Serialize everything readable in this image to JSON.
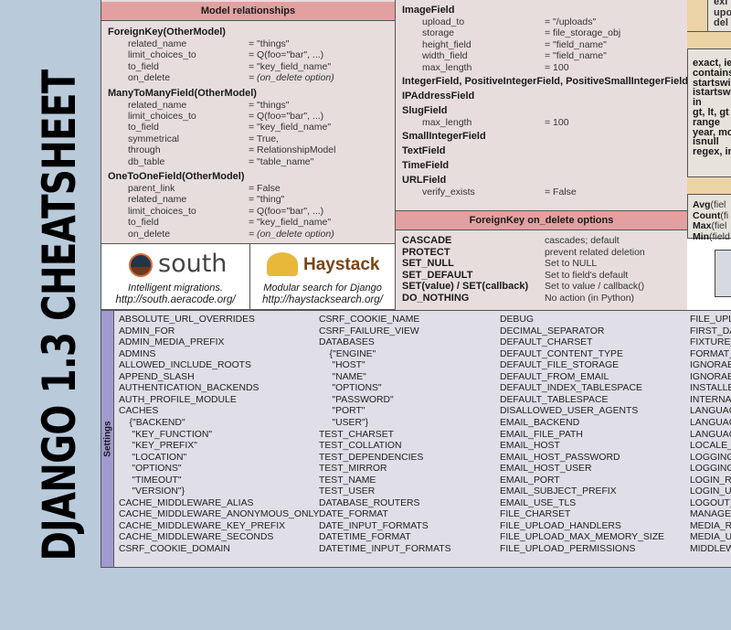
{
  "title": "DJANGO 1.3 CHEATSHEET",
  "model_relationships": {
    "header": "Model relationships",
    "groups": [
      {
        "name": "ForeignKey(OtherModel)",
        "rows": [
          [
            "related_name",
            "= \"things\""
          ],
          [
            "limit_choices_to",
            "= Q(foo=\"bar\", ...)"
          ],
          [
            "to_field",
            "= \"key_field_name\""
          ],
          [
            "on_delete",
            "= (on_delete option)"
          ]
        ]
      },
      {
        "name": "ManyToManyField(OtherModel)",
        "rows": [
          [
            "related_name",
            "= \"things\""
          ],
          [
            "limit_choices_to",
            "= Q(foo=\"bar\", ...)"
          ],
          [
            "to_field",
            "= \"key_field_name\""
          ],
          [
            "symmetrical",
            "= True,"
          ],
          [
            "through",
            "= RelationshipModel"
          ],
          [
            "db_table",
            "= \"table_name\""
          ]
        ]
      },
      {
        "name": "OneToOneField(OtherModel)",
        "rows": [
          [
            "parent_link",
            "= False"
          ],
          [
            "related_name",
            "= \"thing\""
          ],
          [
            "limit_choices_to",
            "= Q(foo=\"bar\", ...)"
          ],
          [
            "to_field",
            "= \"key_field_name\""
          ],
          [
            "on_delete",
            "= (on_delete option)"
          ]
        ]
      }
    ]
  },
  "ads": {
    "south": {
      "logo": "south",
      "tagline": "Intelligent migrations.",
      "url": "http://south.aeracode.org/"
    },
    "haystack": {
      "logo": "Haystack",
      "tagline": "Modular search for Django",
      "url": "http://haystacksearch.org/"
    }
  },
  "fields": [
    {
      "name": "ImageField",
      "rows": [
        [
          "upload_to",
          "= \"/uploads\""
        ],
        [
          "storage",
          "= file_storage_obj"
        ],
        [
          "height_field",
          "= \"field_name\""
        ],
        [
          "width_field",
          "= \"field_name\""
        ],
        [
          "max_length",
          "= 100"
        ]
      ]
    },
    {
      "name": "IntegerField, PositiveIntegerField, PositiveSmallIntegerField",
      "rows": []
    },
    {
      "name": "IPAddressField",
      "rows": []
    },
    {
      "name": "SlugField",
      "rows": [
        [
          "max_length",
          "= 100"
        ]
      ]
    },
    {
      "name": "SmallIntegerField",
      "rows": []
    },
    {
      "name": "TextField",
      "rows": []
    },
    {
      "name": "TimeField",
      "rows": []
    },
    {
      "name": "URLField",
      "rows": [
        [
          "verify_exists",
          "= False"
        ]
      ]
    }
  ],
  "on_delete": {
    "header": "ForeignKey on_delete options",
    "rows": [
      [
        "CASCADE",
        "cascades; default"
      ],
      [
        "PROTECT",
        "prevent related deletion"
      ],
      [
        "SET_NULL",
        "Set to NULL"
      ],
      [
        "SET_DEFAULT",
        "Set to field's default"
      ],
      [
        "SET(value) / SET(callback)",
        "Set to value / callback()"
      ],
      [
        "DO_NOTHING",
        "No action (in Python)"
      ]
    ]
  },
  "right": {
    "top": [
      "exi",
      "upo",
      "del"
    ],
    "lookups": [
      "exact, ie",
      "contains",
      "startswi",
      "istartsw",
      "in",
      "gt, lt, gt",
      "range",
      "year, mo",
      "isnull",
      "regex, ir"
    ],
    "aggregates": [
      [
        "Avg",
        "(fiel"
      ],
      [
        "Count",
        "(fi"
      ],
      [
        "Max",
        "(fiel"
      ],
      [
        "Min",
        "(field"
      ]
    ],
    "book_icon": "book-icon"
  },
  "settings": {
    "label": "Settings",
    "columns": [
      [
        "ABSOLUTE_URL_OVERRIDES",
        "ADMIN_FOR",
        "ADMIN_MEDIA_PREFIX",
        "ADMINS",
        "ALLOWED_INCLUDE_ROOTS",
        "APPEND_SLASH",
        "AUTHENTICATION_BACKENDS",
        "AUTH_PROFILE_MODULE",
        "CACHES",
        "    {\"BACKEND\"",
        "     \"KEY_FUNCTION\"",
        "     \"KEY_PREFIX\"",
        "     \"LOCATION\"",
        "     \"OPTIONS\"",
        "     \"TIMEOUT\"",
        "     \"VERSION\"}",
        "CACHE_MIDDLEWARE_ALIAS",
        "CACHE_MIDDLEWARE_ANONYMOUS_ONLY",
        "CACHE_MIDDLEWARE_KEY_PREFIX",
        "CACHE_MIDDLEWARE_SECONDS",
        "CSRF_COOKIE_DOMAIN"
      ],
      [
        "CSRF_COOKIE_NAME",
        "CSRF_FAILURE_VIEW",
        "DATABASES",
        "    {\"ENGINE\"",
        "     \"HOST\"",
        "     \"NAME\"",
        "     \"OPTIONS\"",
        "     \"PASSWORD\"",
        "     \"PORT\"",
        "     \"USER\"}",
        "TEST_CHARSET",
        "TEST_COLLATION",
        "TEST_DEPENDENCIES",
        "TEST_MIRROR",
        "TEST_NAME",
        "TEST_USER",
        "DATABASE_ROUTERS",
        "DATE_FORMAT",
        "DATE_INPUT_FORMATS",
        "DATETIME_FORMAT",
        "DATETIME_INPUT_FORMATS"
      ],
      [
        "DEBUG",
        "DECIMAL_SEPARATOR",
        "DEFAULT_CHARSET",
        "DEFAULT_CONTENT_TYPE",
        "DEFAULT_FILE_STORAGE",
        "DEFAULT_FROM_EMAIL",
        "DEFAULT_INDEX_TABLESPACE",
        "DEFAULT_TABLESPACE",
        "DISALLOWED_USER_AGENTS",
        "EMAIL_BACKEND",
        "EMAIL_FILE_PATH",
        "EMAIL_HOST",
        "EMAIL_HOST_PASSWORD",
        "EMAIL_HOST_USER",
        "EMAIL_PORT",
        "EMAIL_SUBJECT_PREFIX",
        "EMAIL_USE_TLS",
        "FILE_CHARSET",
        "FILE_UPLOAD_HANDLERS",
        "FILE_UPLOAD_MAX_MEMORY_SIZE",
        "FILE_UPLOAD_PERMISSIONS"
      ],
      [
        "FILE_UPL",
        "FIRST_DA",
        "FIXTURE_",
        "FORMAT_",
        "IGNORAB",
        "IGNORAB",
        "INSTALLE",
        "INTERNA",
        "LANGUAG",
        "LANGUAG",
        "LANGUAG",
        "LOCALE_",
        "LOGGING",
        "LOGGING",
        "LOGIN_R",
        "LOGIN_U",
        "LOGOUT_",
        "MANAGE",
        "MEDIA_R",
        "MEDIA_U",
        "MIDDLEW"
      ]
    ]
  },
  "colors": {
    "background": "#b9cadb",
    "section_header": "#e3a0a0",
    "panel": "#e8dddd",
    "settings_stripe": "#a09ad0",
    "tan": "#ecd3a6"
  }
}
